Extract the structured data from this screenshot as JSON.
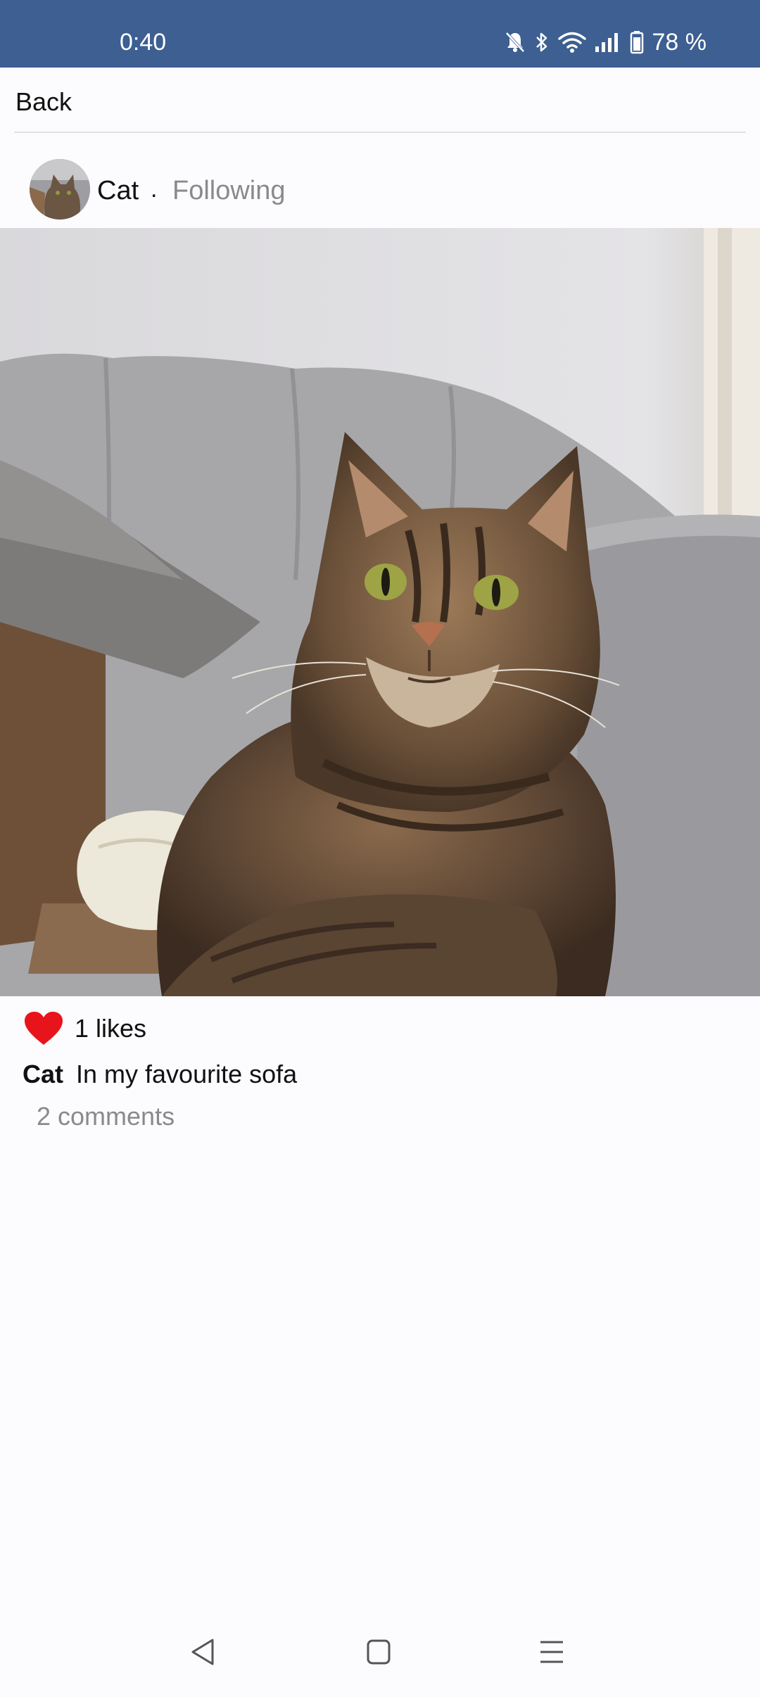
{
  "status_bar": {
    "time": "0:40",
    "battery": "78 %",
    "icons": [
      "mute-icon",
      "bluetooth-icon",
      "wifi-icon",
      "signal-icon",
      "battery-icon"
    ]
  },
  "header": {
    "back_label": "Back"
  },
  "post": {
    "author": "Cat",
    "separator": ".",
    "follow_status": "Following",
    "likes": "1 likes",
    "caption_author": "Cat",
    "caption": "In my favourite sofa",
    "comments": "2 comments"
  },
  "colors": {
    "status_bar": "#3d5f91",
    "like": "#e8141b",
    "muted_text": "#8a8a8d",
    "background": "#fcfbfe"
  },
  "nav": {
    "icons": [
      "back-triangle-icon",
      "home-square-icon",
      "menu-lines-icon"
    ]
  }
}
